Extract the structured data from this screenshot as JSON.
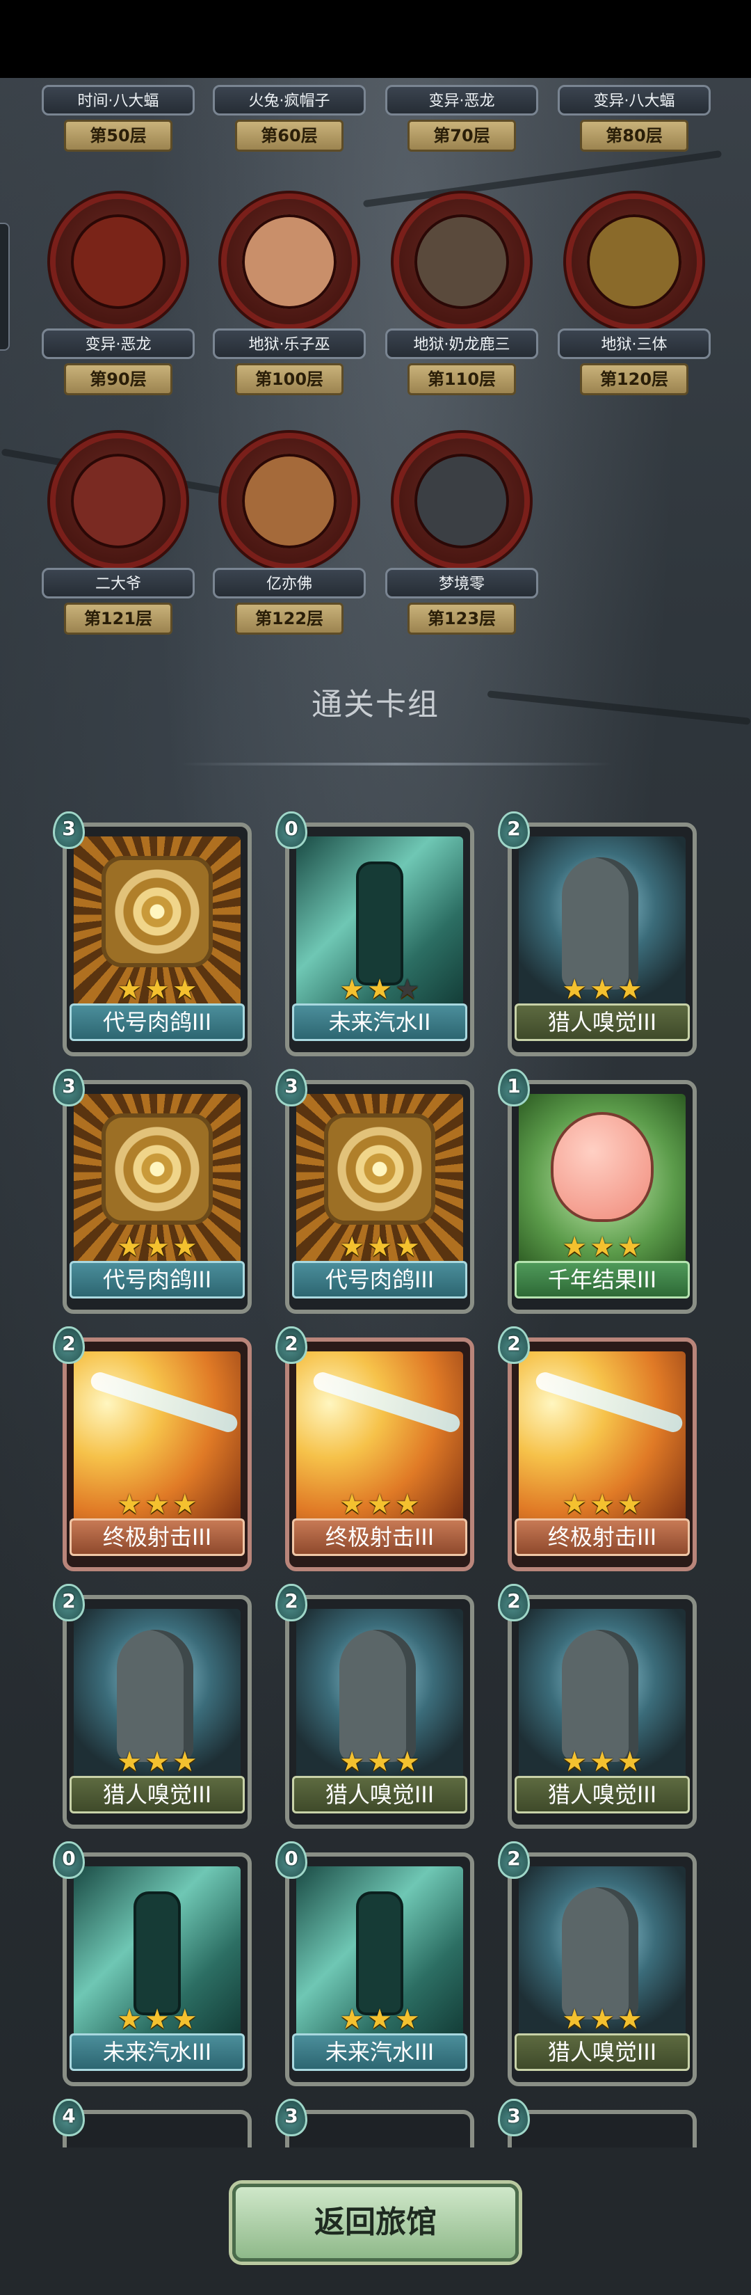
{
  "bosses": [
    {
      "name": "时间·八大蝠",
      "floor": "第50层",
      "color": "#4a1712"
    },
    {
      "name": "火兔·疯帽子",
      "floor": "第60层",
      "color": "#4a1712"
    },
    {
      "name": "变异·恶龙",
      "floor": "第70层",
      "color": "#4a1712"
    },
    {
      "name": "变异·八大蝠",
      "floor": "第80层",
      "color": "#4a1712"
    },
    {
      "name": "变异·恶龙",
      "floor": "第90层",
      "color": "#7a2418"
    },
    {
      "name": "地狱·乐子巫",
      "floor": "第100层",
      "color": "#c98f6a"
    },
    {
      "name": "地狱·奶龙鹿三",
      "floor": "第110层",
      "color": "#5a4a3c"
    },
    {
      "name": "地狱·三体",
      "floor": "第120层",
      "color": "#8a6a2a"
    },
    {
      "name": "二大爷",
      "floor": "第121层",
      "color": "#7a2a22"
    },
    {
      "name": "亿亦佛",
      "floor": "第122层",
      "color": "#a56a3a"
    },
    {
      "name": "梦境零",
      "floor": "第123层",
      "color": "#3b3f44"
    }
  ],
  "section_title": "通关卡组",
  "cards": [
    {
      "name": "代号肉鸽III",
      "cost": "3",
      "stars": 3
    },
    {
      "name": "未来汽水II",
      "cost": "0",
      "stars": 2
    },
    {
      "name": "猎人嗅觉III",
      "cost": "2",
      "stars": 3
    },
    {
      "name": "代号肉鸽III",
      "cost": "3",
      "stars": 3
    },
    {
      "name": "代号肉鸽III",
      "cost": "3",
      "stars": 3
    },
    {
      "name": "千年结果III",
      "cost": "1",
      "stars": 3
    },
    {
      "name": "终极射击III",
      "cost": "2",
      "stars": 3
    },
    {
      "name": "终极射击III",
      "cost": "2",
      "stars": 3
    },
    {
      "name": "终极射击III",
      "cost": "2",
      "stars": 3
    },
    {
      "name": "猎人嗅觉III",
      "cost": "2",
      "stars": 3
    },
    {
      "name": "猎人嗅觉III",
      "cost": "2",
      "stars": 3
    },
    {
      "name": "猎人嗅觉III",
      "cost": "2",
      "stars": 3
    },
    {
      "name": "未来汽水III",
      "cost": "0",
      "stars": 3
    },
    {
      "name": "未来汽水III",
      "cost": "0",
      "stars": 3
    },
    {
      "name": "猎人嗅觉III",
      "cost": "2",
      "stars": 3
    }
  ],
  "partial_cards": [
    {
      "cost": "4"
    },
    {
      "cost": "3"
    },
    {
      "cost": "3"
    }
  ],
  "return_button": "返回旅馆"
}
